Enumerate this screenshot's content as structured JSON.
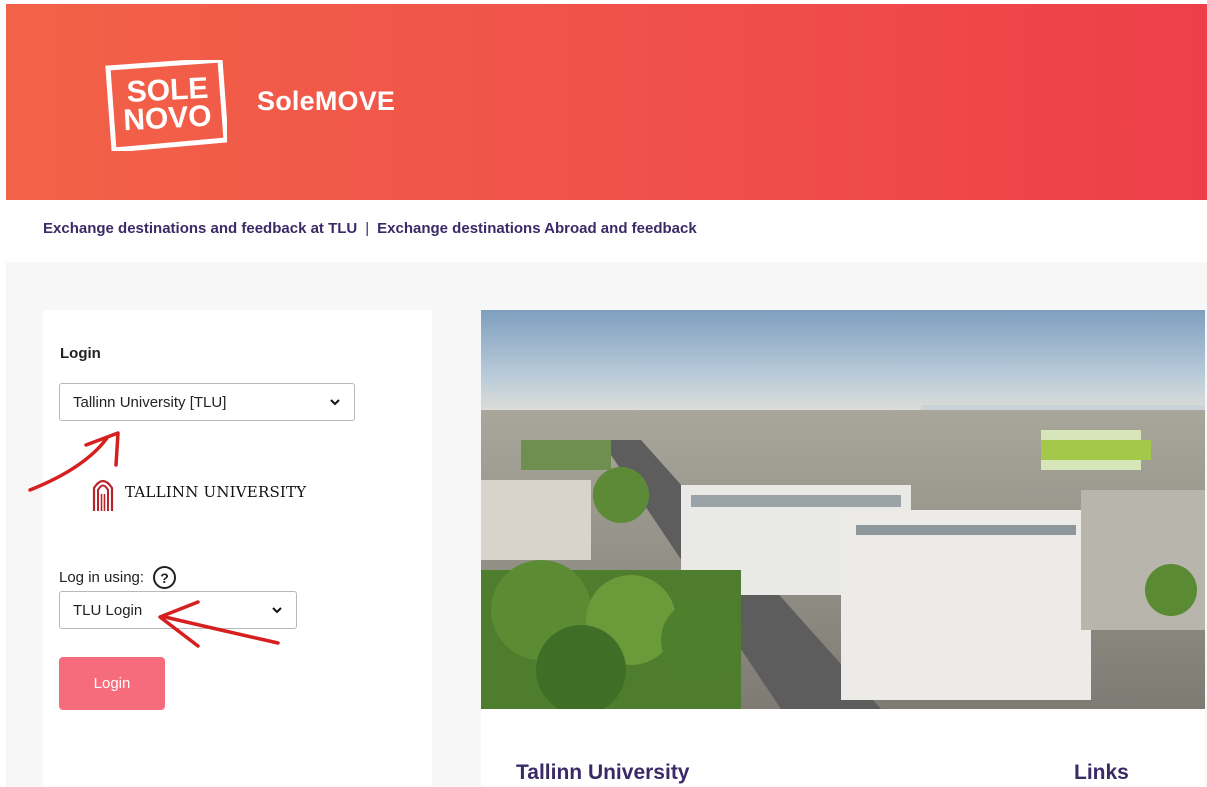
{
  "header": {
    "logo_line1": "SOLE",
    "logo_line2": "NOVO",
    "app_name": "SoleMOVE",
    "gradient_start": "#f26248",
    "gradient_end": "#ee3f49"
  },
  "nav": {
    "link1": "Exchange destinations and feedback at TLU",
    "separator": "|",
    "link2": "Exchange destinations Abroad and feedback"
  },
  "login": {
    "title": "Login",
    "university_selected": "Tallinn University [TLU]",
    "university_logo_text": "TALLINN UNIVERSITY",
    "login_using_label": "Log in using:",
    "help_symbol": "?",
    "method_selected": "TLU Login",
    "button_label": "Login",
    "button_color": "#f76c7c"
  },
  "info": {
    "title": "Tallinn University",
    "links_title": "Links",
    "accent_color": "#3a2a66"
  },
  "icons": {
    "select_chevron": "chevron-down-icon",
    "help": "question-circle-icon",
    "university_emblem": "tlu-emblem-icon"
  },
  "annotation_color": "#d61f1f"
}
